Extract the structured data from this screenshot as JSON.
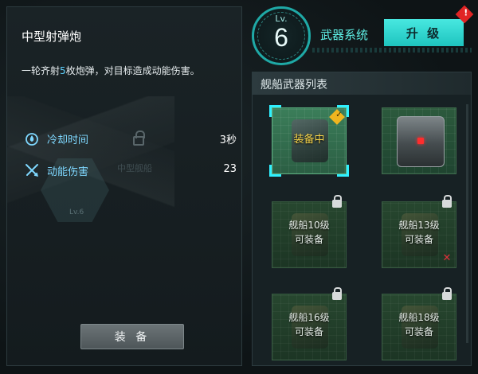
{
  "weapon": {
    "name": "中型射弹炮",
    "desc_prefix": "一轮齐射",
    "desc_count": "5",
    "desc_suffix": "枚炮弹，对目标造成动能伤害。",
    "stats": [
      {
        "icon": "droplet-icon",
        "label": "冷却时间",
        "value": "3秒"
      },
      {
        "icon": "crossed-swords-icon",
        "label": "动能伤害",
        "value": "23"
      }
    ],
    "equip_label": "装 备",
    "ghost_label": "中型舰船",
    "hex_label": "Lv.6"
  },
  "header": {
    "level_prefix": "Lv.",
    "level": "6",
    "system_label": "武器系统",
    "upgrade_label": "升 级",
    "alert_mark": "!"
  },
  "list": {
    "title": "舰船武器列表",
    "slots": [
      {
        "state": "equipped",
        "label": "装备中"
      },
      {
        "state": "available",
        "label": ""
      },
      {
        "state": "locked",
        "line1": "舰船10级",
        "line2": "可装备"
      },
      {
        "state": "locked",
        "line1": "舰船13级",
        "line2": "可装备"
      },
      {
        "state": "locked",
        "line1": "舰船16级",
        "line2": "可装备"
      },
      {
        "state": "locked",
        "line1": "舰船18级",
        "line2": "可装备"
      }
    ]
  },
  "colors": {
    "accent_cyan": "#48e8e0",
    "highlight_blue": "#5fd2ff",
    "equipped_yellow": "#f4d34a",
    "alert_red": "#e12424"
  }
}
